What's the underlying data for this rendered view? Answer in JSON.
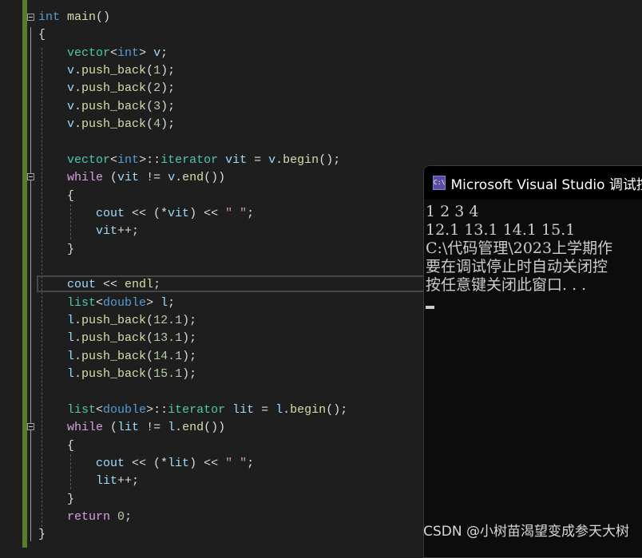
{
  "colors": {
    "background": "#1e1e1e",
    "keyword": "#569cd6",
    "control": "#d8a0df",
    "type": "#4ec9b0",
    "variable": "#9cdcfe",
    "function": "#dcdcaa",
    "number": "#b5cea8",
    "string": "#d69d85",
    "change_bar": "#587c2c"
  },
  "code_lines": [
    [
      [
        "k",
        "int"
      ],
      [
        "p",
        " "
      ],
      [
        "f",
        "main"
      ],
      [
        "p",
        "()"
      ]
    ],
    [
      [
        "p",
        "{"
      ]
    ],
    [
      [
        "p",
        "    "
      ],
      [
        "t",
        "vector"
      ],
      [
        "p",
        "<"
      ],
      [
        "k",
        "int"
      ],
      [
        "p",
        "> "
      ],
      [
        "v",
        "v"
      ],
      [
        "p",
        ";"
      ]
    ],
    [
      [
        "p",
        "    "
      ],
      [
        "v",
        "v"
      ],
      [
        "p",
        "."
      ],
      [
        "f",
        "push_back"
      ],
      [
        "p",
        "("
      ],
      [
        "n",
        "1"
      ],
      [
        "p",
        ");"
      ]
    ],
    [
      [
        "p",
        "    "
      ],
      [
        "v",
        "v"
      ],
      [
        "p",
        "."
      ],
      [
        "f",
        "push_back"
      ],
      [
        "p",
        "("
      ],
      [
        "n",
        "2"
      ],
      [
        "p",
        ");"
      ]
    ],
    [
      [
        "p",
        "    "
      ],
      [
        "v",
        "v"
      ],
      [
        "p",
        "."
      ],
      [
        "f",
        "push_back"
      ],
      [
        "p",
        "("
      ],
      [
        "n",
        "3"
      ],
      [
        "p",
        ");"
      ]
    ],
    [
      [
        "p",
        "    "
      ],
      [
        "v",
        "v"
      ],
      [
        "p",
        "."
      ],
      [
        "f",
        "push_back"
      ],
      [
        "p",
        "("
      ],
      [
        "n",
        "4"
      ],
      [
        "p",
        ");"
      ]
    ],
    [],
    [
      [
        "p",
        "    "
      ],
      [
        "t",
        "vector"
      ],
      [
        "p",
        "<"
      ],
      [
        "k",
        "int"
      ],
      [
        "p",
        ">::"
      ],
      [
        "t",
        "iterator"
      ],
      [
        "p",
        " "
      ],
      [
        "v",
        "vit"
      ],
      [
        "p",
        " = "
      ],
      [
        "v",
        "v"
      ],
      [
        "p",
        "."
      ],
      [
        "f",
        "begin"
      ],
      [
        "p",
        "();"
      ]
    ],
    [
      [
        "p",
        "    "
      ],
      [
        "c",
        "while"
      ],
      [
        "p",
        " ("
      ],
      [
        "v",
        "vit"
      ],
      [
        "p",
        " != "
      ],
      [
        "v",
        "v"
      ],
      [
        "p",
        "."
      ],
      [
        "f",
        "end"
      ],
      [
        "p",
        "())"
      ]
    ],
    [
      [
        "p",
        "    {"
      ]
    ],
    [
      [
        "p",
        "        "
      ],
      [
        "v",
        "cout"
      ],
      [
        "p",
        " << (*"
      ],
      [
        "v",
        "vit"
      ],
      [
        "p",
        ") << "
      ],
      [
        "s",
        "\" \""
      ],
      [
        "p",
        ";"
      ]
    ],
    [
      [
        "p",
        "        "
      ],
      [
        "v",
        "vit"
      ],
      [
        "p",
        "++;"
      ]
    ],
    [
      [
        "p",
        "    }"
      ]
    ],
    [],
    [
      [
        "p",
        "    "
      ],
      [
        "v",
        "cout"
      ],
      [
        "p",
        " << "
      ],
      [
        "f",
        "endl"
      ],
      [
        "p",
        ";"
      ]
    ],
    [
      [
        "p",
        "    "
      ],
      [
        "t",
        "list"
      ],
      [
        "p",
        "<"
      ],
      [
        "k",
        "double"
      ],
      [
        "p",
        "> "
      ],
      [
        "v",
        "l"
      ],
      [
        "p",
        ";"
      ]
    ],
    [
      [
        "p",
        "    "
      ],
      [
        "v",
        "l"
      ],
      [
        "p",
        "."
      ],
      [
        "f",
        "push_back"
      ],
      [
        "p",
        "("
      ],
      [
        "n",
        "12.1"
      ],
      [
        "p",
        ");"
      ]
    ],
    [
      [
        "p",
        "    "
      ],
      [
        "v",
        "l"
      ],
      [
        "p",
        "."
      ],
      [
        "f",
        "push_back"
      ],
      [
        "p",
        "("
      ],
      [
        "n",
        "13.1"
      ],
      [
        "p",
        ");"
      ]
    ],
    [
      [
        "p",
        "    "
      ],
      [
        "v",
        "l"
      ],
      [
        "p",
        "."
      ],
      [
        "f",
        "push_back"
      ],
      [
        "p",
        "("
      ],
      [
        "n",
        "14.1"
      ],
      [
        "p",
        ");"
      ]
    ],
    [
      [
        "p",
        "    "
      ],
      [
        "v",
        "l"
      ],
      [
        "p",
        "."
      ],
      [
        "f",
        "push_back"
      ],
      [
        "p",
        "("
      ],
      [
        "n",
        "15.1"
      ],
      [
        "p",
        ");"
      ]
    ],
    [],
    [
      [
        "p",
        "    "
      ],
      [
        "t",
        "list"
      ],
      [
        "p",
        "<"
      ],
      [
        "k",
        "double"
      ],
      [
        "p",
        ">::"
      ],
      [
        "t",
        "iterator"
      ],
      [
        "p",
        " "
      ],
      [
        "v",
        "lit"
      ],
      [
        "p",
        " = "
      ],
      [
        "v",
        "l"
      ],
      [
        "p",
        "."
      ],
      [
        "f",
        "begin"
      ],
      [
        "p",
        "();"
      ]
    ],
    [
      [
        "p",
        "    "
      ],
      [
        "c",
        "while"
      ],
      [
        "p",
        " ("
      ],
      [
        "v",
        "lit"
      ],
      [
        "p",
        " != "
      ],
      [
        "v",
        "l"
      ],
      [
        "p",
        "."
      ],
      [
        "f",
        "end"
      ],
      [
        "p",
        "())"
      ]
    ],
    [
      [
        "p",
        "    {"
      ]
    ],
    [
      [
        "p",
        "        "
      ],
      [
        "v",
        "cout"
      ],
      [
        "p",
        " << (*"
      ],
      [
        "v",
        "lit"
      ],
      [
        "p",
        ") << "
      ],
      [
        "s",
        "\" \""
      ],
      [
        "p",
        ";"
      ]
    ],
    [
      [
        "p",
        "        "
      ],
      [
        "v",
        "lit"
      ],
      [
        "p",
        "++;"
      ]
    ],
    [
      [
        "p",
        "    }"
      ]
    ],
    [
      [
        "p",
        "    "
      ],
      [
        "c",
        "return"
      ],
      [
        "p",
        " "
      ],
      [
        "n",
        "0"
      ],
      [
        "p",
        ";"
      ]
    ],
    [
      [
        "p",
        "}"
      ]
    ]
  ],
  "console": {
    "icon_label": "C:\\",
    "title": "Microsoft Visual Studio 调试控制台",
    "lines": [
      "1 2 3 4",
      "12.1 13.1 14.1 15.1",
      "C:\\代码管理\\2023上学期作",
      "要在调试停止时自动关闭控",
      "按任意键关闭此窗口. . ."
    ]
  },
  "watermark": "CSDN @小树苗渴望变成参天大树"
}
